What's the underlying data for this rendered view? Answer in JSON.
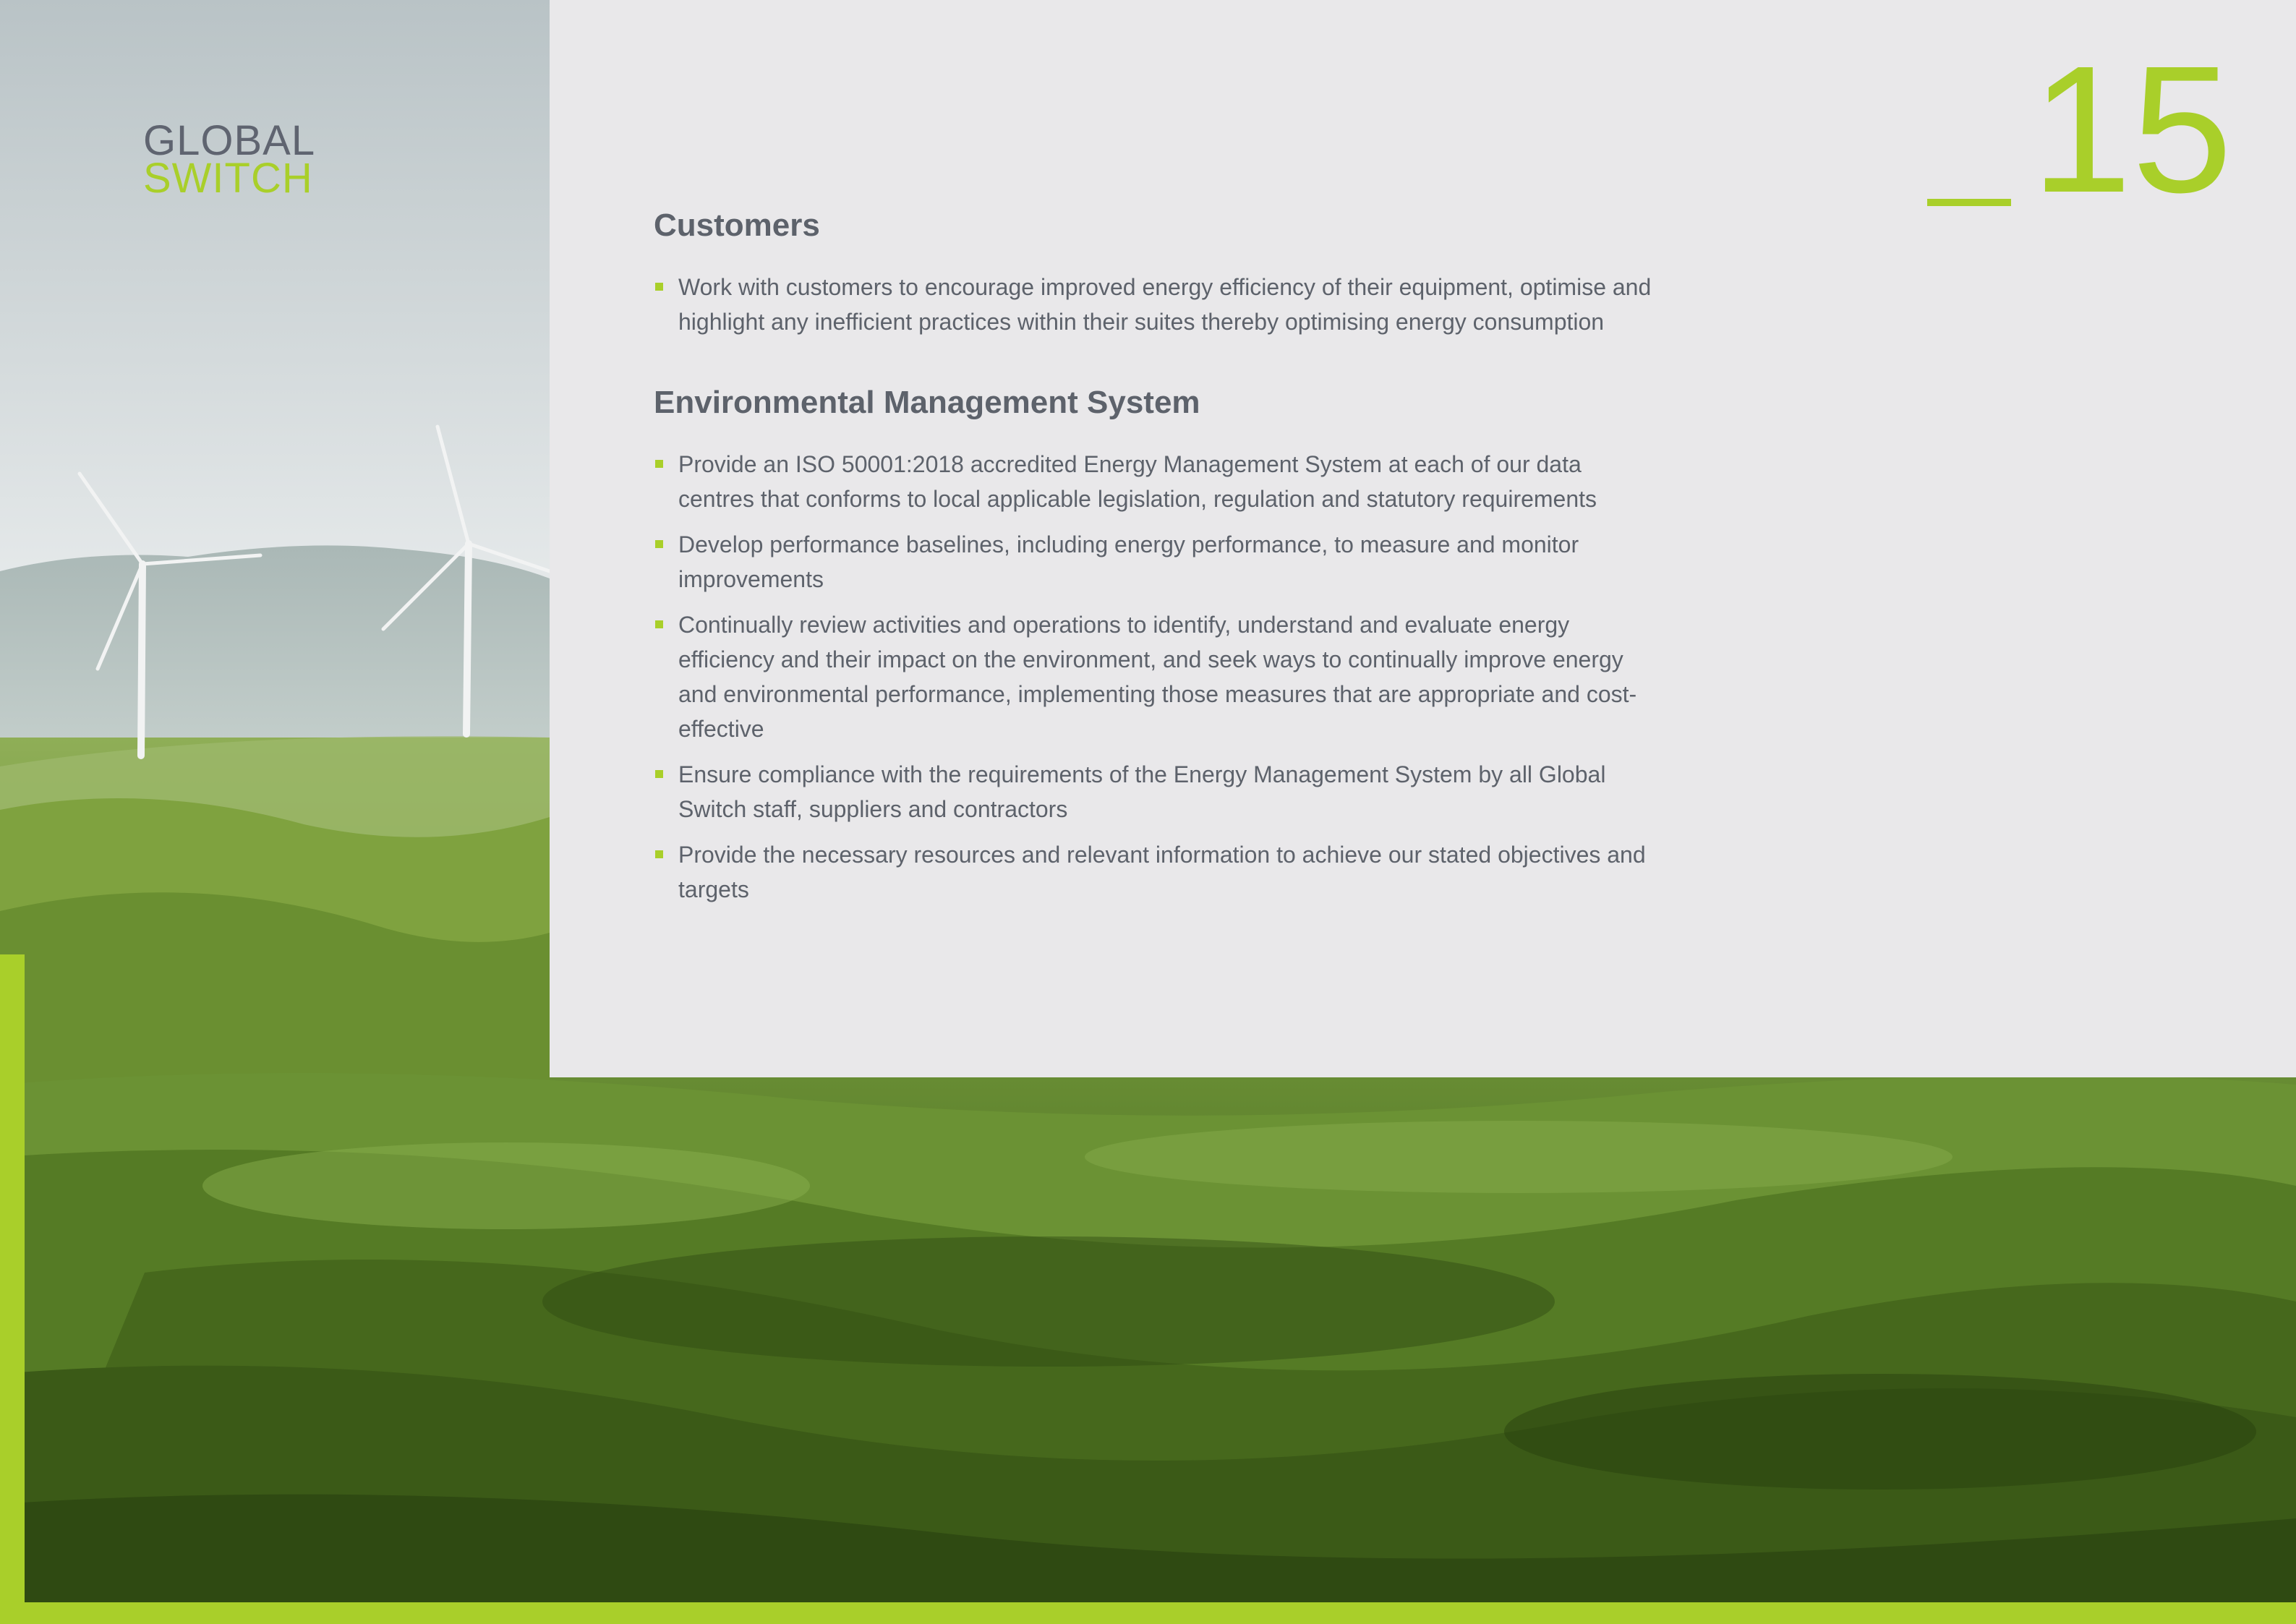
{
  "logo": {
    "line1": "GLOBAL",
    "line2": "SWITCH"
  },
  "page_number": "15",
  "sections": [
    {
      "title": "Customers",
      "items": [
        "Work with customers to encourage improved energy efficiency of their equipment, optimise and highlight any inefficient practices within their suites thereby optimising energy consumption"
      ]
    },
    {
      "title": "Environmental Management System",
      "items": [
        "Provide an ISO 50001:2018 accredited Energy Management System at each of our data centres that conforms to local applicable legislation, regulation and statutory requirements",
        "Develop performance baselines, including energy performance, to measure and monitor improvements",
        "Continually review activities and operations to identify, understand and evaluate energy efficiency and their impact on the environment, and seek ways to continually improve energy and environmental performance, implementing those measures that are appropriate and cost-effective",
        "Ensure compliance with the requirements of the Energy Management System by all Global Switch staff, suppliers and contractors",
        "Provide the necessary resources and relevant information to achieve our stated objectives and targets"
      ]
    }
  ],
  "colors": {
    "accent": "#a9cf2a",
    "text": "#5d626b",
    "panel": "#e9e8ea"
  }
}
